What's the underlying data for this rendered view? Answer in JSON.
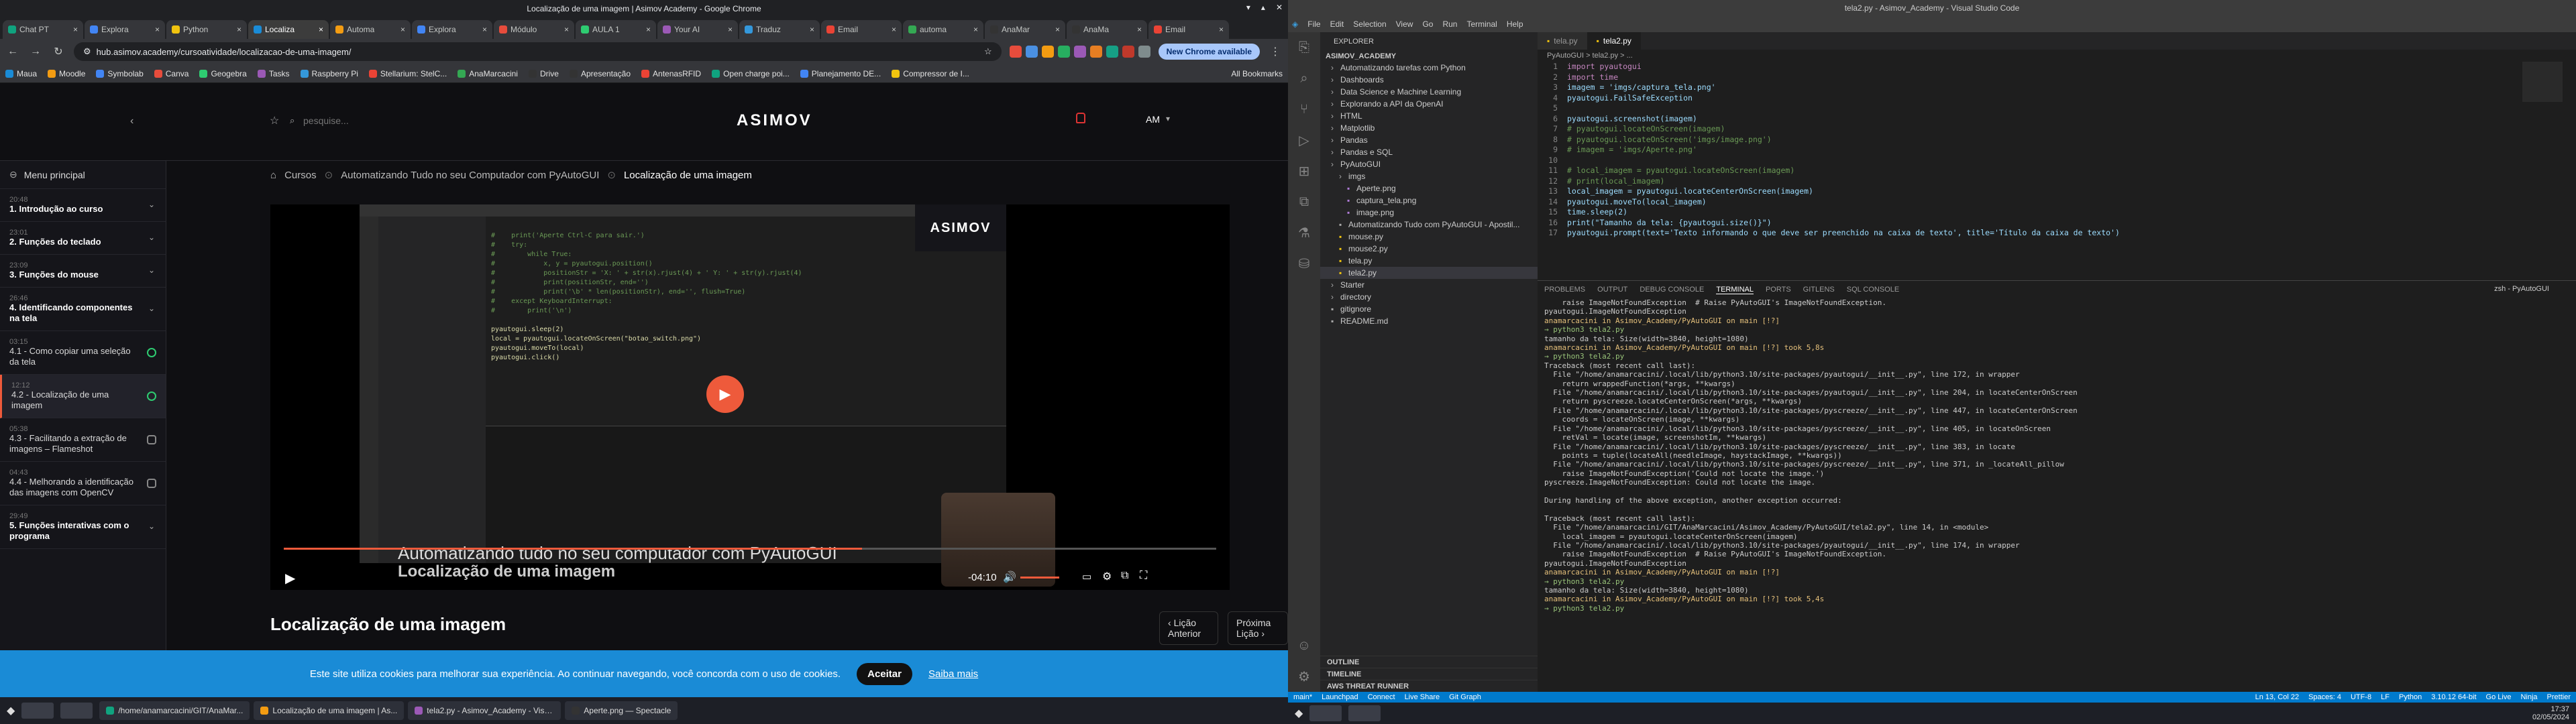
{
  "browser": {
    "window_title": "Localização de uma imagem | Asimov Academy - Google Chrome",
    "tabs": [
      "Chat PT",
      "Explora",
      "Python",
      "Localiza",
      "Automa",
      "Explora",
      "Módulo",
      "AULA 1",
      "Your AI",
      "Traduz",
      "Email",
      "automa",
      "AnaMar",
      "AnaMa",
      "Email"
    ],
    "url": "hub.asimov.academy/cursoatividade/localizacao-de-uma-imagem/",
    "update_label": "New Chrome available",
    "bookmarks": [
      "Maua",
      "Moodle",
      "Symbolab",
      "Canva",
      "Geogebra",
      "Tasks",
      "Raspberry Pi",
      "Stellarium: StelC...",
      "AnaMarcacini",
      "Drive",
      "Apresentação",
      "AntenasRFID",
      "Open charge poi...",
      "Planejamento DE...",
      "Compressor de I..."
    ],
    "all_bookmarks": "All Bookmarks"
  },
  "site": {
    "search_placeholder": "pesquise...",
    "logo": "ASIMOV",
    "user": "AM",
    "menu": "Menu principal",
    "breadcrumb": {
      "cursos": "Cursos",
      "course": "Automatizando Tudo no seu Computador com PyAutoGUI",
      "lesson": "Localização de uma imagem"
    },
    "video": {
      "title": "Automatizando tudo no seu computador com PyAutoGUI",
      "subtitle": "Localização de uma imagem",
      "time": "-04:10",
      "progress": 0.62
    },
    "lesson_title": "Localização de uma imagem",
    "prev": "Lição Anterior",
    "next": "Próxima Lição",
    "sidebar": [
      {
        "time": "20:48",
        "name": "1. Introdução ao curso",
        "module": true
      },
      {
        "time": "23:01",
        "name": "2. Funções do teclado",
        "module": true
      },
      {
        "time": "23:09",
        "name": "3. Funções do mouse",
        "module": true
      },
      {
        "time": "26:46",
        "name": "4. Identificando componentes na tela",
        "module": true
      },
      {
        "time": "03:15",
        "name": "4.1 - Como copiar uma seleção da tela",
        "module": false,
        "done": true
      },
      {
        "time": "12:12",
        "name": "4.2 - Localização de uma imagem",
        "module": false,
        "done": true,
        "active": true
      },
      {
        "time": "05:38",
        "name": "4.3 - Facilitando a extração de imagens – Flameshot",
        "module": false,
        "done": false
      },
      {
        "time": "04:43",
        "name": "4.4 - Melhorando a identificação das imagens com OpenCV",
        "module": false,
        "done": false
      },
      {
        "time": "29:49",
        "name": "5. Funções interativas com o programa",
        "module": true
      }
    ],
    "cookie_text": "Este site utiliza cookies para melhorar sua experiência. Ao continuar navegando, você concorda com o uso de cookies.",
    "cookie_accept": "Aceitar",
    "cookie_more": "Saiba mais"
  },
  "taskbar_left": [
    "/home/anamarcacini/GIT/AnaMar...",
    "Localização de uma imagem | As...",
    "tela2.py - Asimov_Academy - Visua...",
    "Aperte.png — Spectacle"
  ],
  "vscode": {
    "window_title": "tela2.py - Asimov_Academy - Visual Studio Code",
    "menu": [
      "File",
      "Edit",
      "Selection",
      "View",
      "Go",
      "Run",
      "Terminal",
      "Help"
    ],
    "tabs": [
      "tela.py",
      "tela2.py"
    ],
    "breadcrumb": "PyAutoGUI > tela2.py > ...",
    "explorer_title": "EXPLORER",
    "explorer_root": "ASIMOV_ACADEMY",
    "files": [
      "Automatizando tarefas com Python",
      "Dashboards",
      "Data Science e Machine Learning",
      "Explorando a API da OpenAI",
      "HTML",
      "Matplotlib",
      "Pandas",
      "Pandas e SQL",
      "PyAutoGUI",
      "imgs",
      "Aperte.png",
      "captura_tela.png",
      "image.png",
      "Automatizando Tudo com PyAutoGUI - Apostil...",
      "mouse.py",
      "mouse2.py",
      "tela.py",
      "tela2.py",
      "Starter",
      "directory",
      "gitignore",
      "README.md"
    ],
    "outline": [
      "OUTLINE",
      "TIMELINE",
      "AWS THREAT RUNNER"
    ],
    "code": [
      "import pyautogui",
      "import time",
      "imagem = 'imgs/captura_tela.png'",
      "pyautogui.FailSafeException",
      "",
      "pyautogui.screenshot(imagem)",
      "# pyautogui.locateOnScreen(imagem)",
      "# pyautogui.locateOnScreen('imgs/image.png')",
      "# imagem = 'imgs/Aperte.png'",
      "",
      "# local_imagem = pyautogui.locateOnScreen(imagem)",
      "# print(local_imagem)",
      "local_imagem = pyautogui.locateCenterOnScreen(imagem)",
      "pyautogui.moveTo(local_imagem)",
      "time.sleep(2)",
      "print(\"Tamanho da tela: {pyautogui.size()}\")",
      "pyautogui.prompt(text='Texto informando o que deve ser preenchido na caixa de texto', title='Título da caixa de texto')"
    ],
    "panel_tabs": [
      "PROBLEMS",
      "OUTPUT",
      "DEBUG CONSOLE",
      "TERMINAL",
      "PORTS",
      "GITLENS",
      "SQL CONSOLE"
    ],
    "terminal": [
      "    raise ImageNotFoundException  # Raise PyAutoGUI's ImageNotFoundException.",
      "pyautogui.ImageNotFoundException",
      "anamarcacini in Asimov_Academy/PyAutoGUI on main [!?]",
      "→ python3 tela2.py",
      "tamanho da tela: Size(width=3840, height=1080)",
      "anamarcacini in Asimov_Academy/PyAutoGUI on main [!?] took 5,8s",
      "→ python3 tela2.py",
      "Traceback (most recent call last):",
      "  File \"/home/anamarcacini/.local/lib/python3.10/site-packages/pyautogui/__init__.py\", line 172, in wrapper",
      "    return wrappedFunction(*args, **kwargs)",
      "  File \"/home/anamarcacini/.local/lib/python3.10/site-packages/pyautogui/__init__.py\", line 204, in locateCenterOnScreen",
      "    return pyscreeze.locateCenterOnScreen(*args, **kwargs)",
      "  File \"/home/anamarcacini/.local/lib/python3.10/site-packages/pyscreeze/__init__.py\", line 447, in locateCenterOnScreen",
      "    coords = locateOnScreen(image, **kwargs)",
      "  File \"/home/anamarcacini/.local/lib/python3.10/site-packages/pyscreeze/__init__.py\", line 405, in locateOnScreen",
      "    retVal = locate(image, screenshotIm, **kwargs)",
      "  File \"/home/anamarcacini/.local/lib/python3.10/site-packages/pyscreeze/__init__.py\", line 383, in locate",
      "    points = tuple(locateAll(needleImage, haystackImage, **kwargs))",
      "  File \"/home/anamarcacini/.local/lib/python3.10/site-packages/pyscreeze/__init__.py\", line 371, in _locateAll_pillow",
      "    raise ImageNotFoundException('Could not locate the image.')",
      "pyscreeze.ImageNotFoundException: Could not locate the image.",
      "",
      "During handling of the above exception, another exception occurred:",
      "",
      "Traceback (most recent call last):",
      "  File \"/home/anamarcacini/GIT/AnaMarcacini/Asimov_Academy/PyAutoGUI/tela2.py\", line 14, in <module>",
      "    local_imagem = pyautogui.locateCenterOnScreen(imagem)",
      "  File \"/home/anamarcacini/.local/lib/python3.10/site-packages/pyautogui/__init__.py\", line 174, in wrapper",
      "    raise ImageNotFoundException  # Raise PyAutoGUI's ImageNotFoundException.",
      "pyautogui.ImageNotFoundException",
      "anamarcacini in Asimov_Academy/PyAutoGUI on main [!?]",
      "→ python3 tela2.py",
      "tamanho da tela: Size(width=3840, height=1080)",
      "anamarcacini in Asimov_Academy/PyAutoGUI on main [!?] took 5,4s",
      "→ python3 tela2.py"
    ],
    "terminal_label": "zsh - PyAutoGUI",
    "status": {
      "branch": "main*",
      "launch": "Launchpad",
      "connect": "Connect",
      "share": "Live Share",
      "git": "Git Graph",
      "pos": "Ln 13, Col 22",
      "spaces": "Spaces: 4",
      "enc": "UTF-8",
      "eol": "LF",
      "lang": "Python",
      "ver": "3.10.12 64-bit",
      "live": "Go Live",
      "ninja": "Ninja",
      "prettier": "Prettier"
    }
  },
  "clock": {
    "time": "17:37",
    "date": "02/05/2024"
  }
}
